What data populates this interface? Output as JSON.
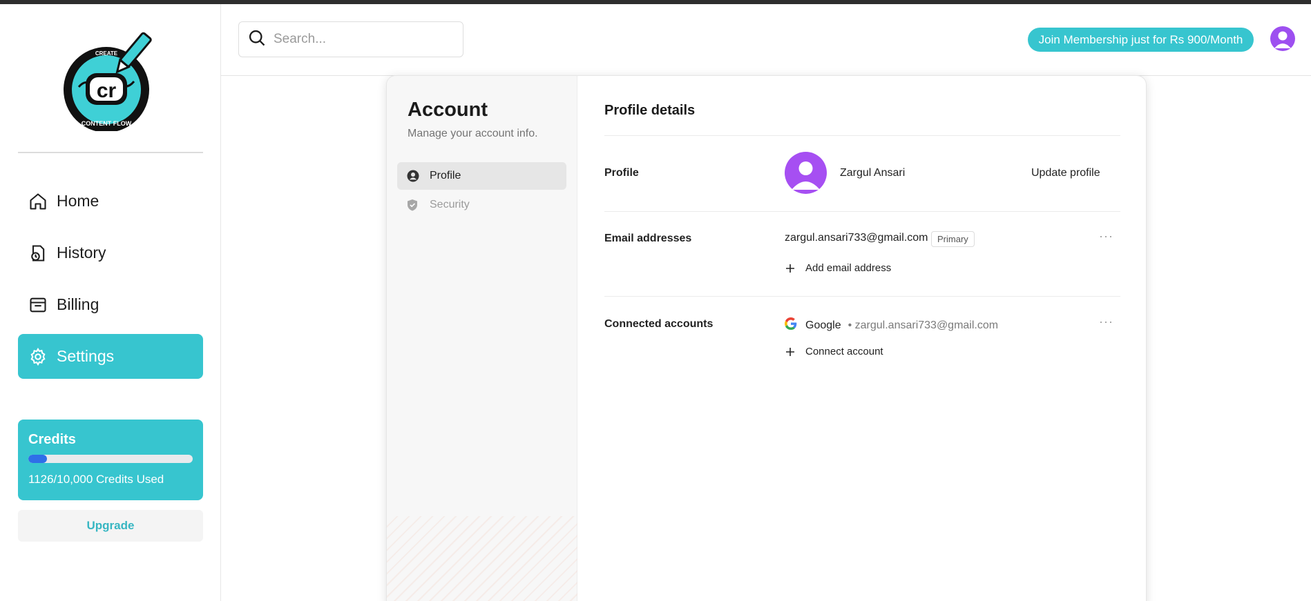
{
  "sidebar": {
    "logo": {
      "top_text": "CREATE",
      "monogram": "cr",
      "bottom_text": "CONTENT FLOW"
    },
    "nav": [
      {
        "label": "Home",
        "icon": "home-icon",
        "active": false
      },
      {
        "label": "History",
        "icon": "history-icon",
        "active": false
      },
      {
        "label": "Billing",
        "icon": "billing-icon",
        "active": true
      },
      {
        "label": "Settings",
        "icon": "gear-icon",
        "active": true
      }
    ],
    "credits": {
      "title": "Credits",
      "used_text": "1126/10,000 Credits Used",
      "used_fraction": 0.1126
    },
    "upgrade_label": "Upgrade"
  },
  "header": {
    "search_placeholder": "Search...",
    "membership_label": "Join Membership just for Rs 900/Month"
  },
  "account": {
    "title": "Account",
    "subtitle": "Manage your account info.",
    "tabs": [
      {
        "label": "Profile",
        "icon": "user-circle-icon"
      },
      {
        "label": "Security",
        "icon": "shield-icon"
      }
    ]
  },
  "profile_details": {
    "title": "Profile details",
    "profile_label": "Profile",
    "name": "Zargul Ansari",
    "update_label": "Update profile",
    "email_label": "Email addresses",
    "email": "zargul.ansari733@gmail.com",
    "primary_badge": "Primary",
    "add_email_label": "Add email address",
    "connected_label": "Connected accounts",
    "provider": "Google",
    "provider_email": "• zargul.ansari733@gmail.com",
    "connect_label": "Connect account",
    "more_label": "···"
  },
  "colors": {
    "accent": "#37c5cf",
    "avatar": "#a64ff2",
    "progress": "#2f6fe8"
  }
}
